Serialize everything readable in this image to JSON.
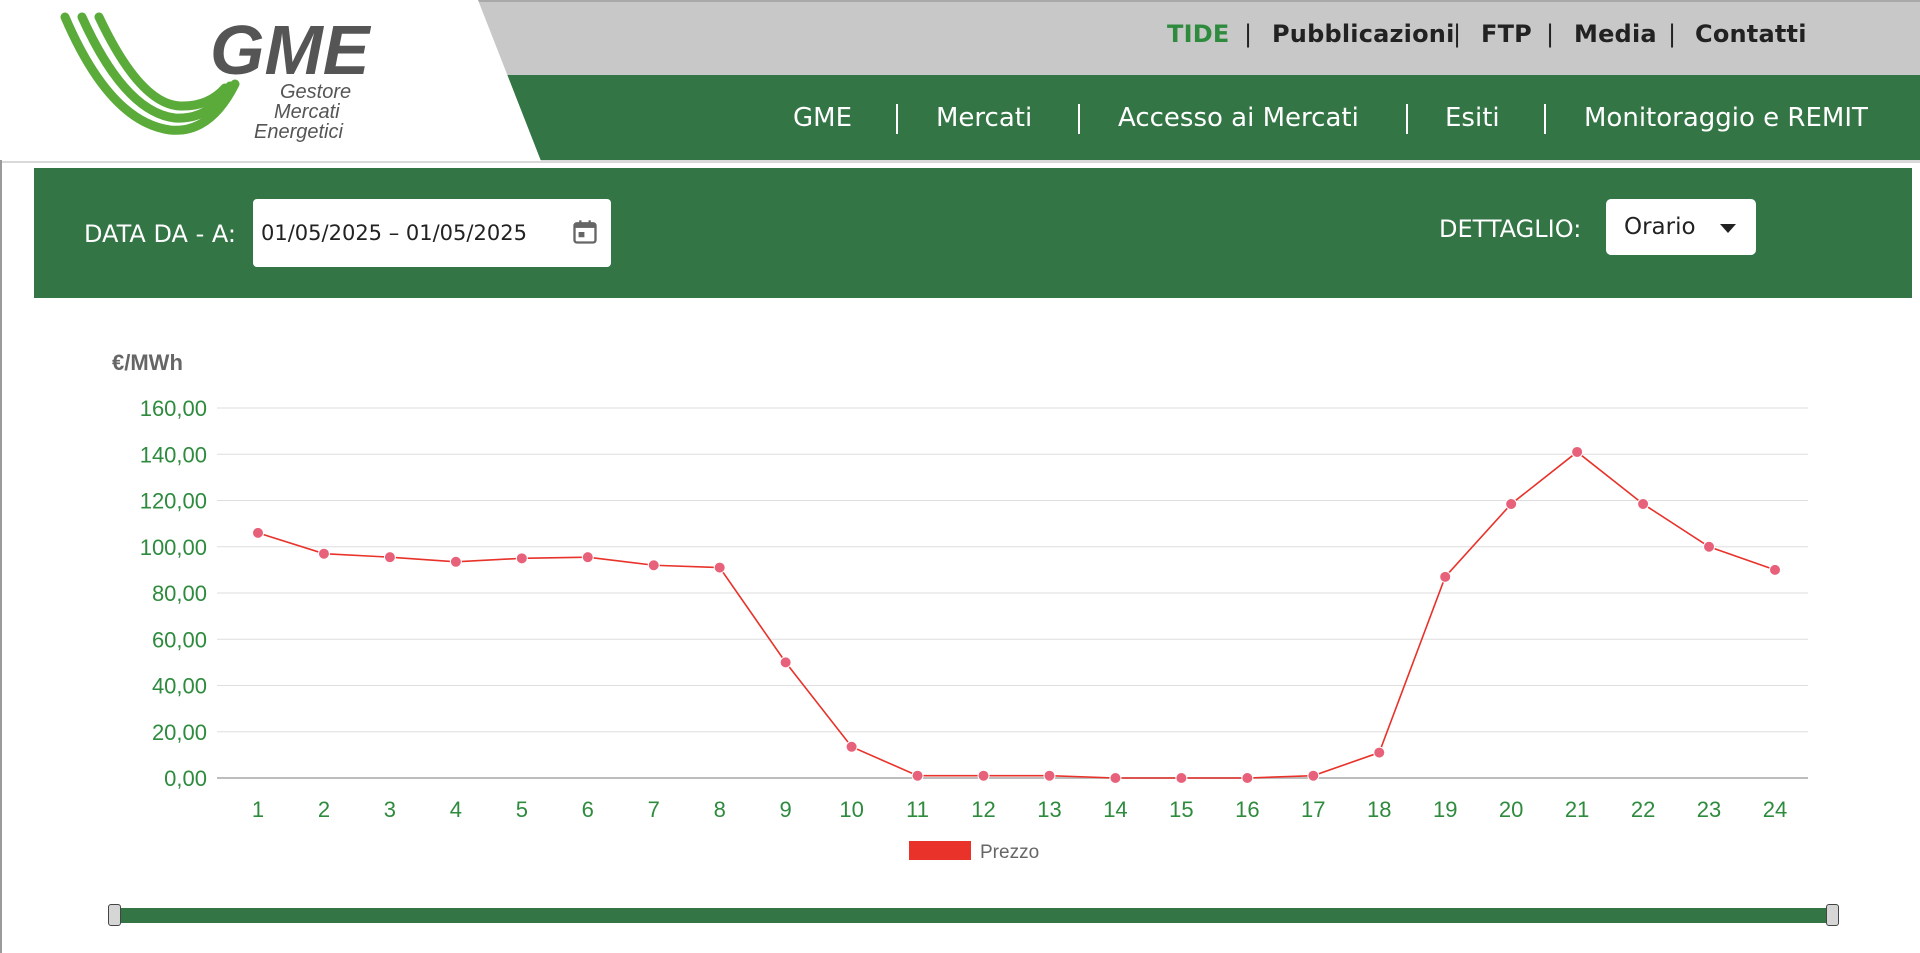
{
  "brand": {
    "logo_text": "GME",
    "tagline_lines": [
      "Gestore",
      "Mercati",
      "Energetici"
    ],
    "colors": {
      "green_dark": "#337545",
      "green_logo": "#5aab3a",
      "grey_logo": "#555555"
    }
  },
  "utility_nav": {
    "items": [
      {
        "label": "TIDE",
        "active": true
      },
      {
        "label": "Pubblicazioni"
      },
      {
        "label": "FTP"
      },
      {
        "label": "Media"
      },
      {
        "label": "Contatti"
      }
    ],
    "separator": "|"
  },
  "main_nav": {
    "items": [
      {
        "label": "GME"
      },
      {
        "label": "Mercati"
      },
      {
        "label": "Accesso ai Mercati"
      },
      {
        "label": "Esiti"
      },
      {
        "label": "Monitoraggio e REMIT"
      }
    ]
  },
  "filters": {
    "date_label": "DATA DA - A:",
    "date_value": "01/05/2025 – 01/05/2025",
    "date_icon": "calendar-icon",
    "detail_label": "DETTAGLIO:",
    "detail_value": "Orario"
  },
  "chart_data": {
    "type": "line",
    "title": "",
    "xlabel": "",
    "ylabel": "€/MWh",
    "x": [
      1,
      2,
      3,
      4,
      5,
      6,
      7,
      8,
      9,
      10,
      11,
      12,
      13,
      14,
      15,
      16,
      17,
      18,
      19,
      20,
      21,
      22,
      23,
      24
    ],
    "series": [
      {
        "name": "Prezzo",
        "line_color": "#e8322a",
        "marker_color": "#e8617a",
        "legend_color": "#e8322a",
        "values": [
          106,
          97,
          95.5,
          93.5,
          95,
          95.5,
          92,
          91,
          50,
          13.5,
          1,
          1,
          1,
          0,
          0,
          0,
          1,
          11,
          87,
          118.5,
          141,
          118.5,
          100,
          90
        ]
      }
    ],
    "yticks": [
      "0,00",
      "20,00",
      "40,00",
      "60,00",
      "80,00",
      "100,00",
      "120,00",
      "140,00",
      "160,00"
    ],
    "ylim": [
      0,
      160
    ],
    "grid": true,
    "legend_position": "bottom-left",
    "tick_color": "#2e8b3e"
  },
  "range_slider": {
    "start": 0,
    "end": 1
  }
}
